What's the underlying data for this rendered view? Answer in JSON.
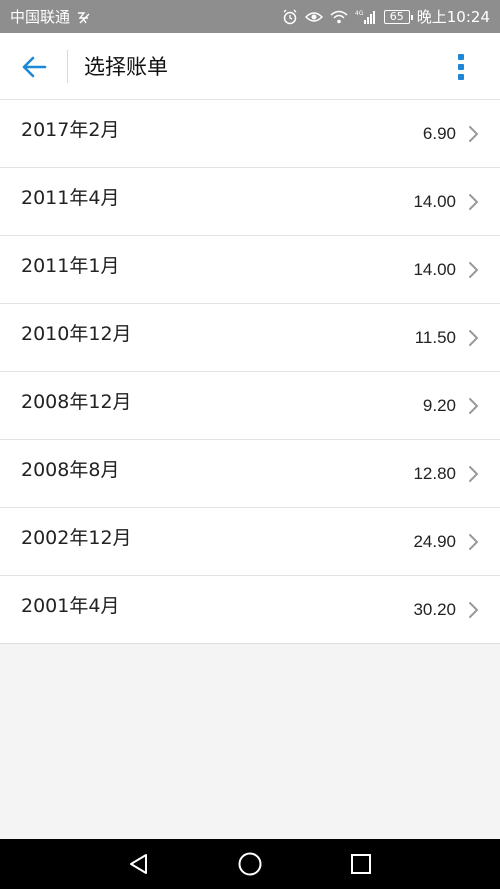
{
  "status_bar": {
    "carrier": "中国联通",
    "network": "4G",
    "battery": "65",
    "time": "晚上10:24"
  },
  "app_bar": {
    "title": "选择账单"
  },
  "bills": [
    {
      "period": "2017年2月",
      "amount": "6.90"
    },
    {
      "period": "2011年4月",
      "amount": "14.00"
    },
    {
      "period": "2011年1月",
      "amount": "14.00"
    },
    {
      "period": "2010年12月",
      "amount": "11.50"
    },
    {
      "period": "2008年12月",
      "amount": "9.20"
    },
    {
      "period": "2008年8月",
      "amount": "12.80"
    },
    {
      "period": "2002年12月",
      "amount": "24.90"
    },
    {
      "period": "2001年4月",
      "amount": "30.20"
    }
  ],
  "colors": {
    "accent": "#1e88d6",
    "status_bar_bg": "#8e8e8e",
    "page_bg": "#f4f4f4",
    "nav_bar_bg": "#000000"
  },
  "icons": {
    "back": "arrow-left-icon",
    "menu": "more-vertical-icon",
    "chevron": "chevron-right-icon",
    "nav_back": "triangle-back-icon",
    "nav_home": "circle-home-icon",
    "nav_recents": "square-recents-icon"
  }
}
